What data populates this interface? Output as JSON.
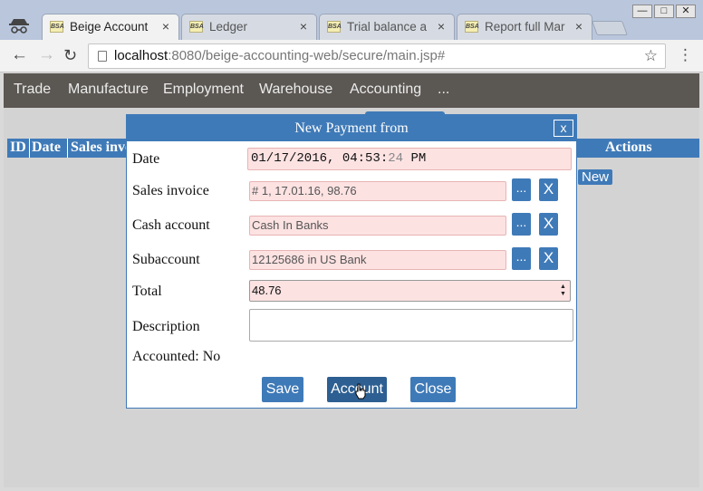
{
  "browser": {
    "tabs": [
      {
        "favicon_text": "BSA",
        "title": "Beige Account",
        "active": true
      },
      {
        "favicon_text": "BSA",
        "title": "Ledger",
        "active": false
      },
      {
        "favicon_text": "BSA",
        "title": "Trial balance a",
        "active": false
      },
      {
        "favicon_text": "BSA",
        "title": "Report full Mar",
        "active": false
      }
    ],
    "tab_close_glyph": "×",
    "url_host": "localhost",
    "url_rest": ":8080/beige-accounting-web/secure/main.jsp#",
    "window_controls": {
      "minimize": "—",
      "maximize": "□",
      "close": "✕"
    }
  },
  "menu": [
    "Trade",
    "Manufacture",
    "Employment",
    "Warehouse",
    "Accounting",
    "..."
  ],
  "table": {
    "headers": [
      "ID",
      "Date",
      "Sales invo",
      "Actions"
    ],
    "new_button": "New"
  },
  "dialog": {
    "title": "New Payment from",
    "close": "x",
    "fields": {
      "date": {
        "label": "Date",
        "value_main": "01/17/2016, 04:53:",
        "value_sec": "24",
        "value_suffix": " PM"
      },
      "sales_invoice": {
        "label": "Sales invoice",
        "value": "# 1, 17.01.16, 98.76"
      },
      "cash_account": {
        "label": "Cash account",
        "value": "Cash In Banks"
      },
      "subaccount": {
        "label": "Subaccount",
        "value": "12125686 in US Bank"
      },
      "total": {
        "label": "Total",
        "value": "48.76"
      },
      "description": {
        "label": "Description",
        "value": ""
      }
    },
    "picker_button": "...",
    "clear_button": "X",
    "accounted": "Accounted: No",
    "buttons": {
      "save": "Save",
      "account": "Account",
      "close": "Close"
    }
  },
  "colors": {
    "accent": "#3f7ab8",
    "menubar": "#5b5753",
    "required_field": "#fde2e2"
  }
}
